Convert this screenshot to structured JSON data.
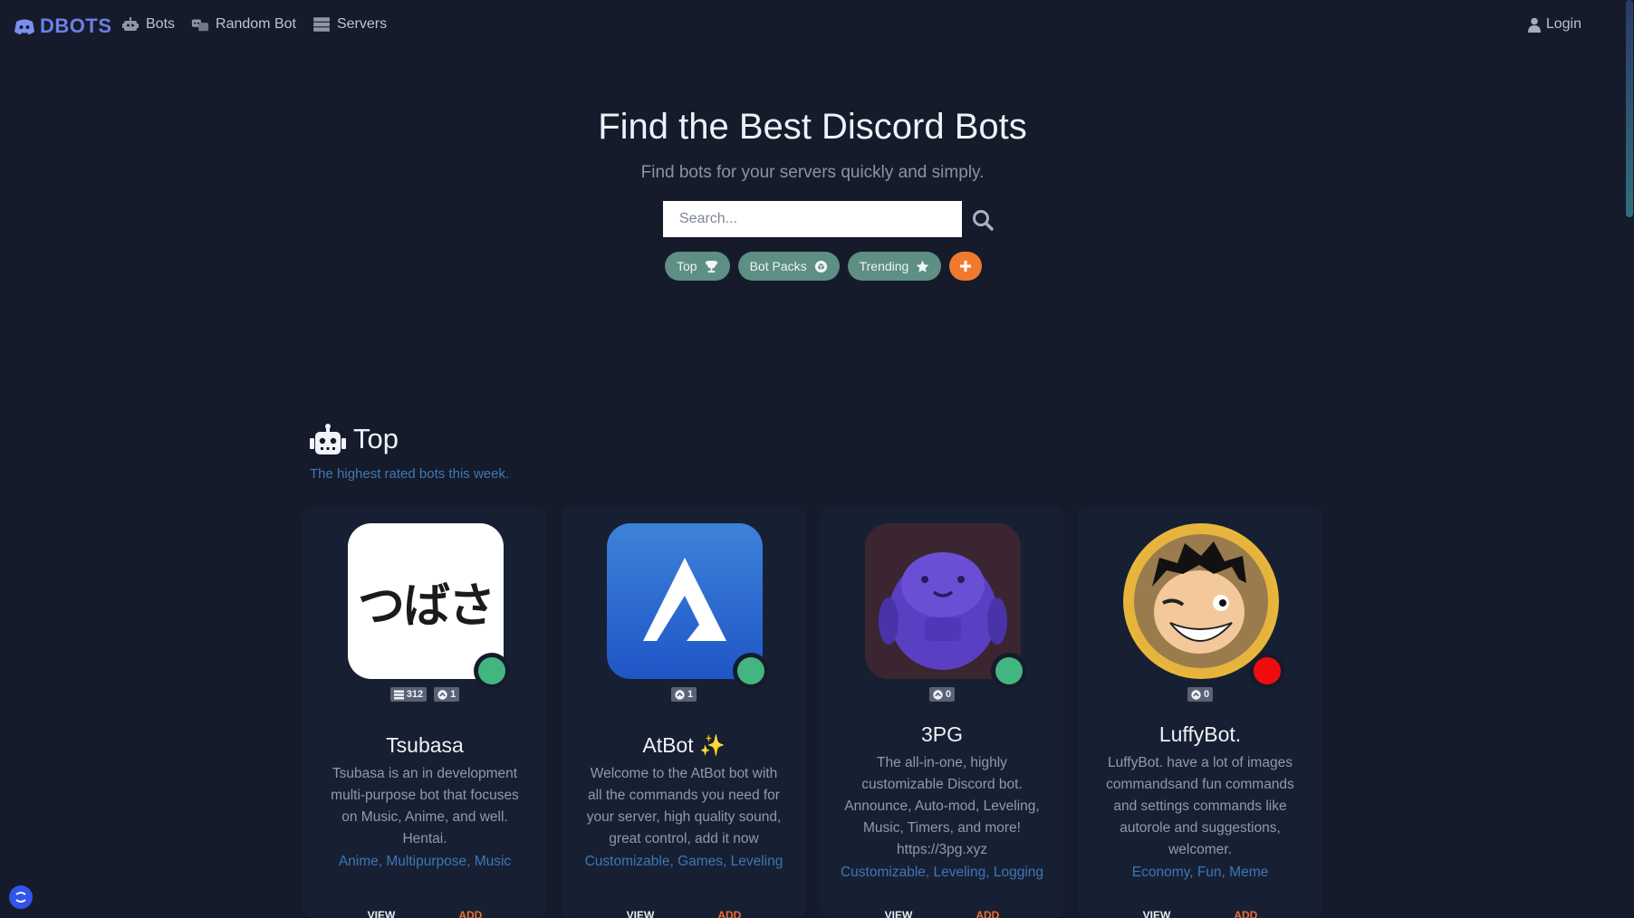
{
  "brand": {
    "name": "DBOTS",
    "icon": "discord-logo-icon"
  },
  "nav": {
    "items": [
      {
        "label": "Bots",
        "icon": "robot-icon"
      },
      {
        "label": "Random Bot",
        "icon": "robots-icon"
      },
      {
        "label": "Servers",
        "icon": "server-icon"
      }
    ],
    "login": "Login"
  },
  "hero": {
    "title": "Find the Best Discord Bots",
    "subtitle": "Find bots for your servers quickly and simply.",
    "search_placeholder": "Search..."
  },
  "tags": [
    {
      "label": "Top",
      "icon": "trophy-icon"
    },
    {
      "label": "Bot Packs",
      "icon": "box-icon"
    },
    {
      "label": "Trending",
      "icon": "star-icon"
    }
  ],
  "section": {
    "title": "Top",
    "subtitle": "The highest rated bots this week."
  },
  "bots": [
    {
      "name": "Tsubasa",
      "avatar_text": "つばさ",
      "status_color": "#43b581",
      "servers": "312",
      "votes": "1",
      "description": "Tsubasa is an in development multi-purpose bot that focuses on Music, Anime, and well. Hentai.",
      "tags": "Anime, Multipurpose, Music",
      "view": "VIEW",
      "add": "ADD"
    },
    {
      "name": "AtBot ✨",
      "status_color": "#43b581",
      "votes": "1",
      "description": "Welcome to the AtBot bot with all the commands you need for your server, high quality sound, great control, add it now",
      "tags": "Customizable, Games, Leveling",
      "view": "VIEW",
      "add": "ADD"
    },
    {
      "name": "3PG",
      "status_color": "#43b581",
      "votes": "0",
      "description": "The all-in-one, highly customizable Discord bot. Announce, Auto-mod, Leveling, Music, Timers, and more! https://3pg.xyz",
      "tags": "Customizable, Leveling, Logging",
      "view": "VIEW",
      "add": "ADD"
    },
    {
      "name": "LuffyBot.",
      "status_color": "#f00c0c",
      "votes": "0",
      "description": "LuffyBot. have a lot of images commandsand fun commands and settings commands like autorole and suggestions, welcomer.",
      "tags": "Economy, Fun, Meme",
      "view": "VIEW",
      "add": "ADD"
    }
  ]
}
